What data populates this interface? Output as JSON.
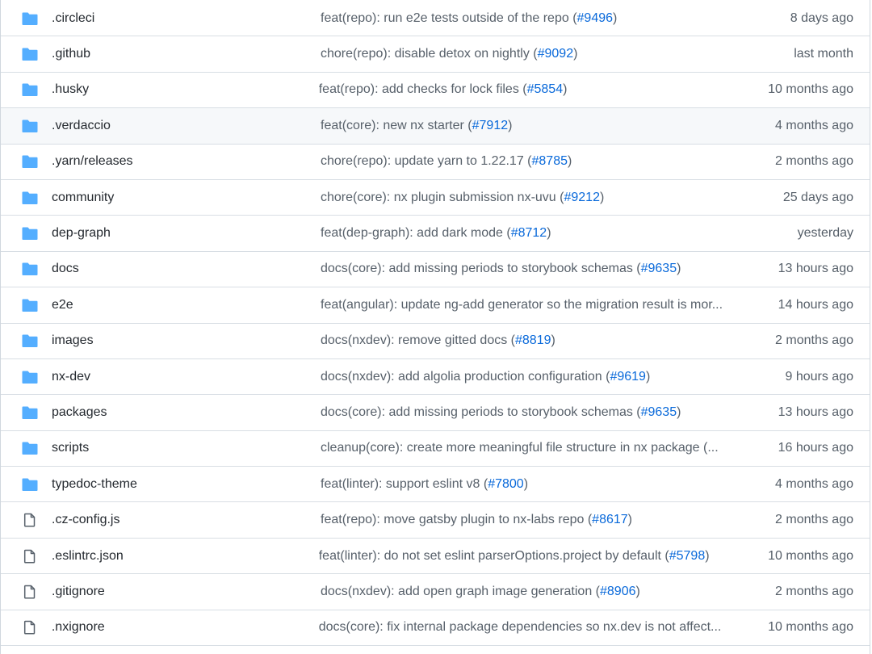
{
  "colors": {
    "folder": "#54aeff",
    "file": "#57606a",
    "link": "#0969da",
    "muted": "#57606a",
    "text": "#24292f",
    "row_highlight": "#f6f8fa"
  },
  "rows": [
    {
      "type": "folder",
      "icon": "folder-icon",
      "name": ".circleci",
      "msg": "feat(repo): run e2e tests outside of the repo (",
      "pr": "#9496",
      "suffix": ")",
      "age": "8 days ago"
    },
    {
      "type": "folder",
      "icon": "folder-icon",
      "name": ".github",
      "msg": "chore(repo): disable detox on nightly (",
      "pr": "#9092",
      "suffix": ")",
      "age": "last month"
    },
    {
      "type": "folder",
      "icon": "folder-icon",
      "name": ".husky",
      "msg": "feat(repo): add checks for lock files (",
      "pr": "#5854",
      "suffix": ")",
      "age": "10 months ago"
    },
    {
      "type": "folder",
      "icon": "folder-icon",
      "name": ".verdaccio",
      "msg": "feat(core): new nx starter (",
      "pr": "#7912",
      "suffix": ")",
      "age": "4 months ago",
      "highlight": true
    },
    {
      "type": "folder",
      "icon": "folder-icon",
      "name": ".yarn/releases",
      "msg": "chore(repo): update yarn to 1.22.17 (",
      "pr": "#8785",
      "suffix": ")",
      "age": "2 months ago"
    },
    {
      "type": "folder",
      "icon": "folder-icon",
      "name": "community",
      "msg": "chore(core): nx plugin submission nx-uvu (",
      "pr": "#9212",
      "suffix": ")",
      "age": "25 days ago"
    },
    {
      "type": "folder",
      "icon": "folder-icon",
      "name": "dep-graph",
      "msg": "feat(dep-graph): add dark mode (",
      "pr": "#8712",
      "suffix": ")",
      "age": "yesterday"
    },
    {
      "type": "folder",
      "icon": "folder-icon",
      "name": "docs",
      "msg": "docs(core): add missing periods to storybook schemas (",
      "pr": "#9635",
      "suffix": ")",
      "age": "13 hours ago"
    },
    {
      "type": "folder",
      "icon": "folder-icon",
      "name": "e2e",
      "msg": "feat(angular): update ng-add generator so the migration result is mor...",
      "pr": "",
      "suffix": "",
      "age": "14 hours ago"
    },
    {
      "type": "folder",
      "icon": "folder-icon",
      "name": "images",
      "msg": "docs(nxdev): remove gitted docs (",
      "pr": "#8819",
      "suffix": ")",
      "age": "2 months ago"
    },
    {
      "type": "folder",
      "icon": "folder-icon",
      "name": "nx-dev",
      "msg": "docs(nxdev): add algolia production configuration (",
      "pr": "#9619",
      "suffix": ")",
      "age": "9 hours ago"
    },
    {
      "type": "folder",
      "icon": "folder-icon",
      "name": "packages",
      "msg": "docs(core): add missing periods to storybook schemas (",
      "pr": "#9635",
      "suffix": ")",
      "age": "13 hours ago"
    },
    {
      "type": "folder",
      "icon": "folder-icon",
      "name": "scripts",
      "msg": "cleanup(core): create more meaningful file structure in nx package (...",
      "pr": "",
      "suffix": "",
      "age": "16 hours ago"
    },
    {
      "type": "folder",
      "icon": "folder-icon",
      "name": "typedoc-theme",
      "msg": "feat(linter): support eslint v8 (",
      "pr": "#7800",
      "suffix": ")",
      "age": "4 months ago"
    },
    {
      "type": "file",
      "icon": "file-icon",
      "name": ".cz-config.js",
      "msg": "feat(repo): move gatsby plugin to nx-labs repo (",
      "pr": "#8617",
      "suffix": ")",
      "age": "2 months ago"
    },
    {
      "type": "file",
      "icon": "file-icon",
      "name": ".eslintrc.json",
      "msg": "feat(linter): do not set eslint parserOptions.project by default (",
      "pr": "#5798",
      "suffix": ")",
      "age": "10 months ago"
    },
    {
      "type": "file",
      "icon": "file-icon",
      "name": ".gitignore",
      "msg": "docs(nxdev): add open graph image generation (",
      "pr": "#8906",
      "suffix": ")",
      "age": "2 months ago"
    },
    {
      "type": "file",
      "icon": "file-icon",
      "name": ".nxignore",
      "msg": "docs(core): fix internal package dependencies so nx.dev is not affect...",
      "pr": "",
      "suffix": "",
      "age": "10 months ago"
    }
  ]
}
